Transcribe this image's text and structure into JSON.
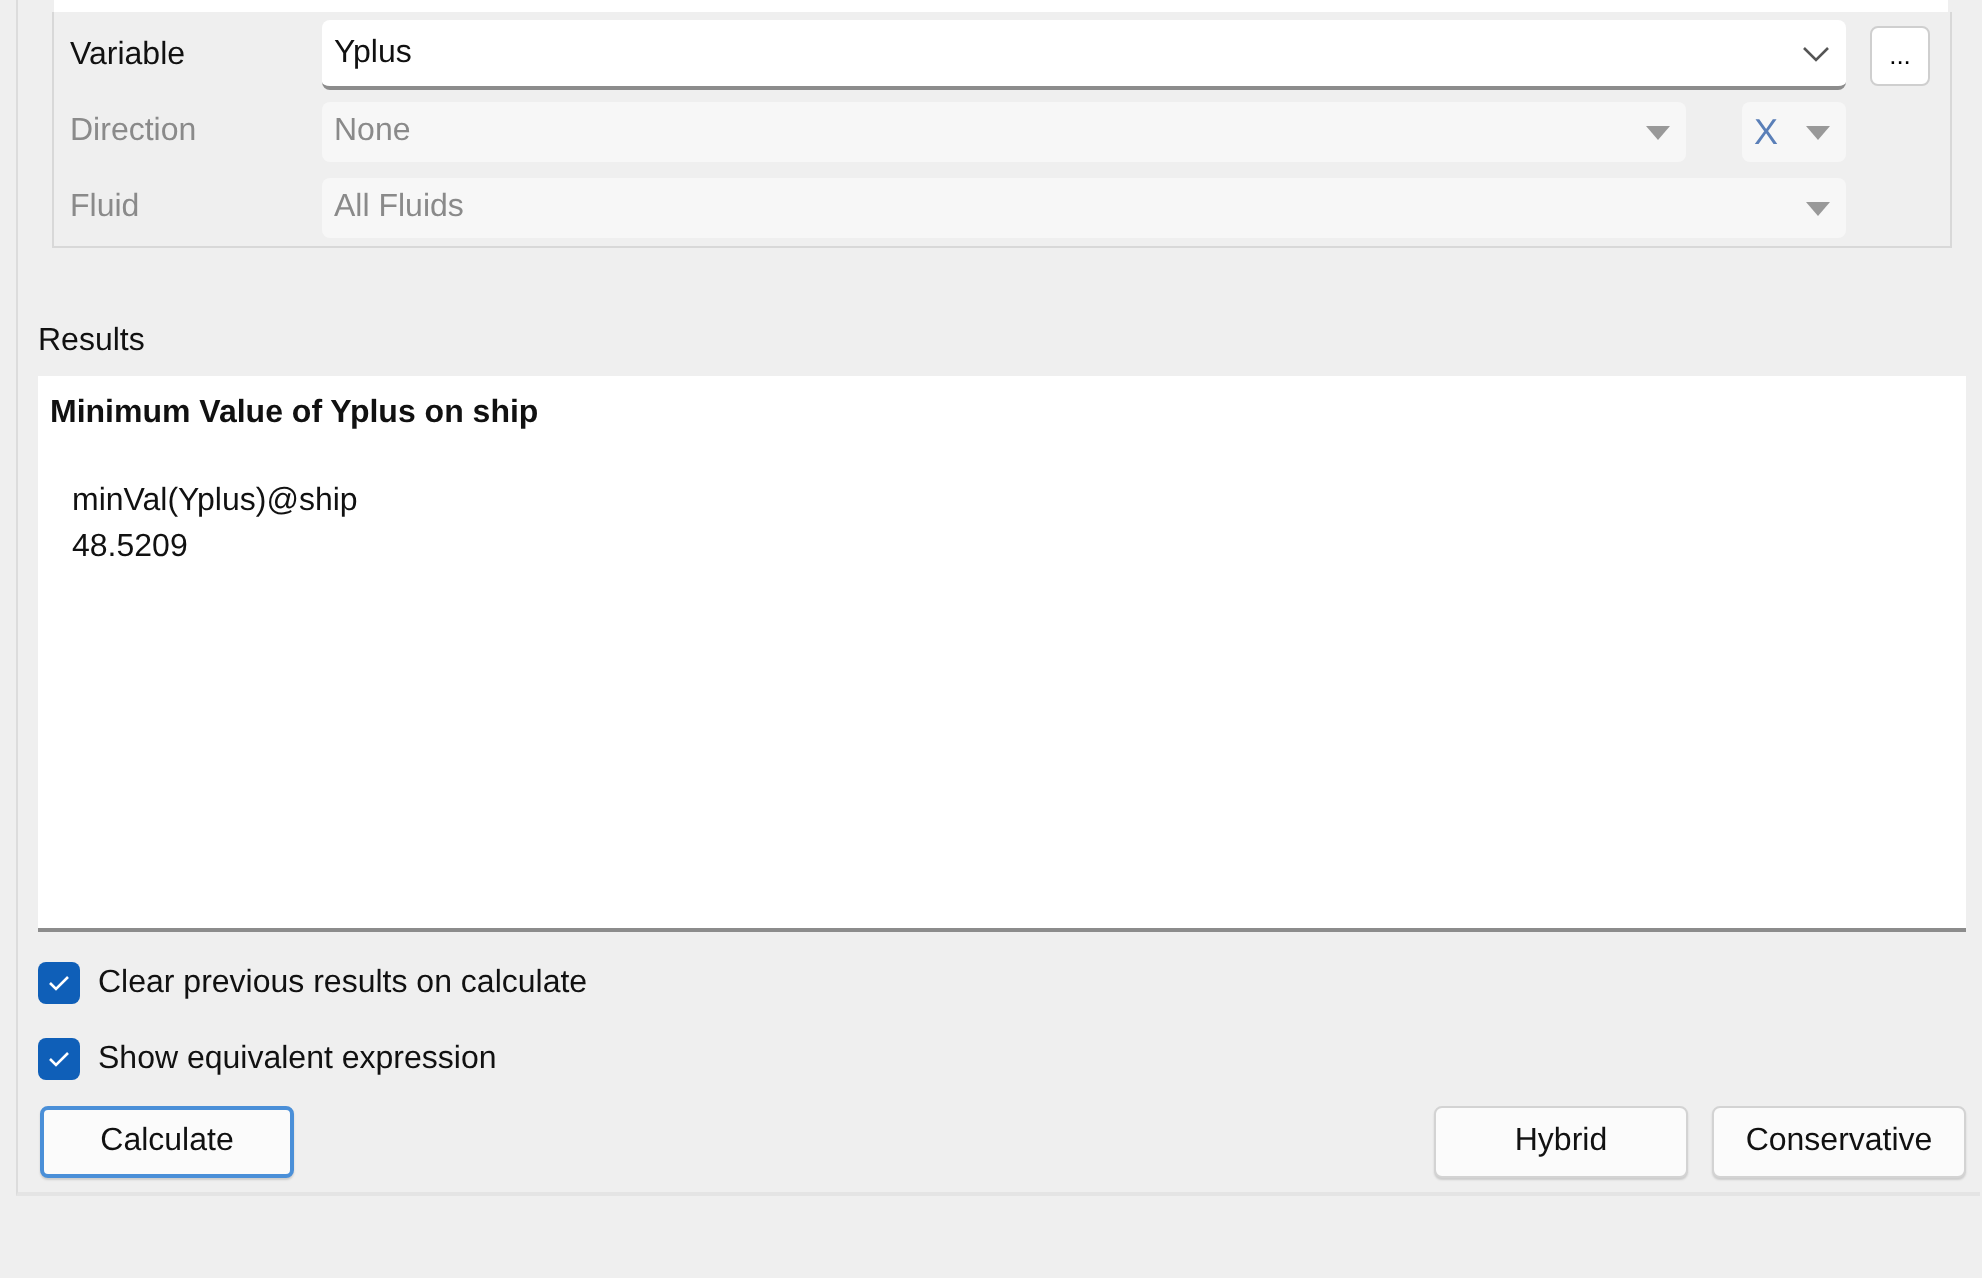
{
  "form": {
    "rows": [
      {
        "label": "Variable",
        "value": "Yplus",
        "disabled": false,
        "more_button": "..."
      },
      {
        "label": "Direction",
        "value": "None",
        "disabled": true,
        "component": "X"
      },
      {
        "label": "Fluid",
        "value": "All Fluids",
        "disabled": true
      }
    ]
  },
  "results": {
    "label": "Results",
    "title": "Minimum Value of Yplus on ship",
    "lines": [
      "minVal(Yplus)@ship",
      "48.5209"
    ]
  },
  "options": [
    {
      "label": "Clear previous results on calculate",
      "checked": true
    },
    {
      "label": "Show equivalent expression",
      "checked": true
    }
  ],
  "buttons": {
    "left": [
      {
        "label": "Calculate",
        "focused": true
      }
    ],
    "right": [
      {
        "label": "Hybrid",
        "focused": false
      },
      {
        "label": "Conservative",
        "focused": false
      }
    ]
  }
}
